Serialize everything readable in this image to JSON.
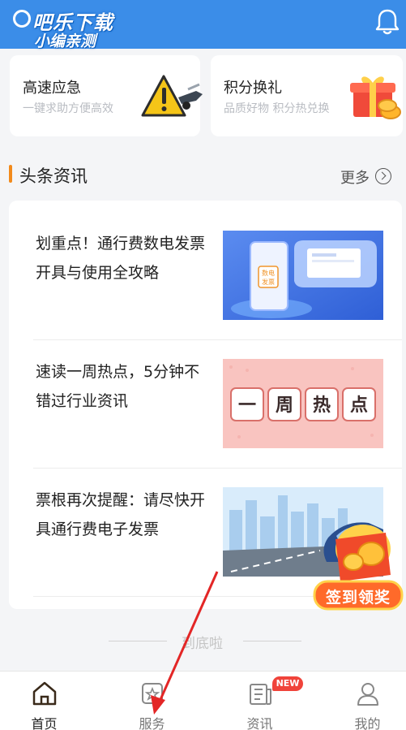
{
  "watermark": {
    "line1": "吧乐下载",
    "line2": "小编亲测"
  },
  "header": {
    "bell_icon": "bell-icon"
  },
  "cards": [
    {
      "title": "高速应急",
      "subtitle": "一键求助方便高效",
      "icon": "warning-triangle-icon"
    },
    {
      "title": "积分换礼",
      "subtitle": "品质好物 积分热兑换",
      "icon": "gift-box-icon"
    }
  ],
  "section": {
    "title": "头条资讯",
    "more": "更多"
  },
  "news": [
    {
      "title": "划重点！通行费数电发票开具与使用全攻略",
      "thumb_badge": [
        "数电",
        "发票"
      ]
    },
    {
      "title": "速读一周热点，5分钟不错过行业资讯",
      "thumb_chars": [
        "一",
        "周",
        "热",
        "点"
      ]
    },
    {
      "title": "票根再次提醒：请尽快开具通行费电子发票"
    }
  ],
  "footer_end": "到底啦",
  "sign_badge": "签到领奖",
  "nav": {
    "tabs": [
      {
        "label": "首页",
        "icon": "home-icon",
        "active": true
      },
      {
        "label": "服务",
        "icon": "service-icon",
        "active": false
      },
      {
        "label": "资讯",
        "icon": "news-icon",
        "active": false
      },
      {
        "label": "我的",
        "icon": "user-icon",
        "active": false
      }
    ],
    "new_badge": "NEW"
  },
  "colors": {
    "topbar": "#3b8de8",
    "accent": "#f28a1b",
    "badge": "#f0433a"
  }
}
